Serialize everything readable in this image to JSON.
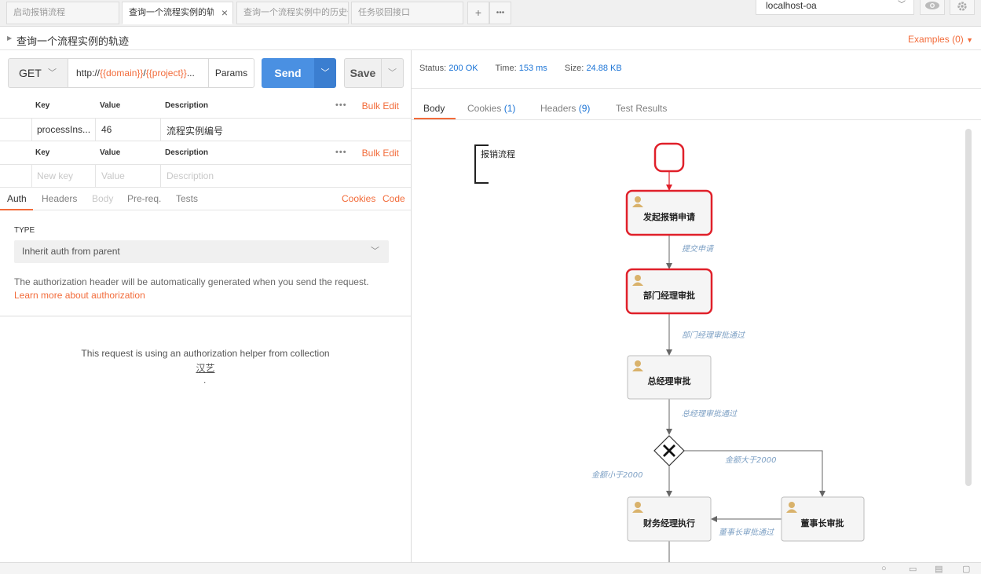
{
  "tabs": [
    {
      "label": "启动报销流程",
      "active": false
    },
    {
      "label": "查询一个流程实例的轨迹",
      "active": true
    },
    {
      "label": "查询一个流程实例中的历史任",
      "active": false
    },
    {
      "label": "任务驳回接口",
      "active": false
    }
  ],
  "tab_actions": {
    "add": "+",
    "more": "•••"
  },
  "environment": {
    "selected": "localhost-oa"
  },
  "icons": {
    "eye": "eye-icon",
    "settings": "gear-icon"
  },
  "request": {
    "name": "查询一个流程实例的轨迹",
    "examples": "Examples (0)",
    "method": "GET",
    "url_prefix": "http://",
    "url_var1": "{{domain}}",
    "url_sep": "/",
    "url_var2": "{{project}}",
    "url_ellipsis": "...",
    "params_label": "Params",
    "send_label": "Send",
    "save_label": "Save"
  },
  "params_table": {
    "headers": {
      "key": "Key",
      "value": "Value",
      "description": "Description"
    },
    "bulk_edit": "Bulk Edit",
    "rows": [
      {
        "key": "processIns...",
        "value": "46",
        "description": "流程实例编号"
      }
    ]
  },
  "headers_table": {
    "headers": {
      "key": "Key",
      "value": "Value",
      "description": "Description"
    },
    "bulk_edit": "Bulk Edit",
    "placeholders": {
      "key": "New key",
      "value": "Value",
      "description": "Description"
    }
  },
  "request_tabs": {
    "auth": "Auth",
    "headers": "Headers",
    "body": "Body",
    "prereq": "Pre-req.",
    "tests": "Tests",
    "cookies": "Cookies",
    "code": "Code"
  },
  "auth": {
    "type_label": "TYPE",
    "type_value": "Inherit auth from parent",
    "note": "The authorization header will be automatically generated when you send the request.",
    "learn_more": "Learn more about authorization",
    "helper_text": "This request is using an authorization helper from collection",
    "collection_name": "汉艺",
    "trailing": "."
  },
  "response": {
    "status_label": "Status:",
    "status_value": "200 OK",
    "time_label": "Time:",
    "time_value": "153 ms",
    "size_label": "Size:",
    "size_value": "24.88 KB",
    "tabs": {
      "body": "Body",
      "cookies": "Cookies",
      "cookies_count": "(1)",
      "headers": "Headers",
      "headers_count": "(9)",
      "test_results": "Test Results"
    }
  },
  "diagram": {
    "pool_label": "报销流程",
    "nodes": {
      "start_apply": "发起报销申请",
      "dept_mgr": "部门经理审批",
      "gm": "总经理审批",
      "finance": "财务经理执行",
      "chairman": "董事长审批"
    },
    "flows": {
      "submit": "提交申请",
      "dept_pass": "部门经理审批通过",
      "gm_pass": "总经理审批通过",
      "gt2000": "金额大于2000",
      "lt2000": "金额小于2000",
      "chair_pass": "董事长审批通过"
    },
    "colors": {
      "highlight": "#e0202a",
      "node_fill": "#f5f5f5",
      "node_border": "#bdbdbd",
      "flow_label": "#7da0c4"
    }
  },
  "accent_colors": {
    "orange": "#f26b3a",
    "blue": "#4a90e2",
    "value_blue": "#1b74d6"
  }
}
